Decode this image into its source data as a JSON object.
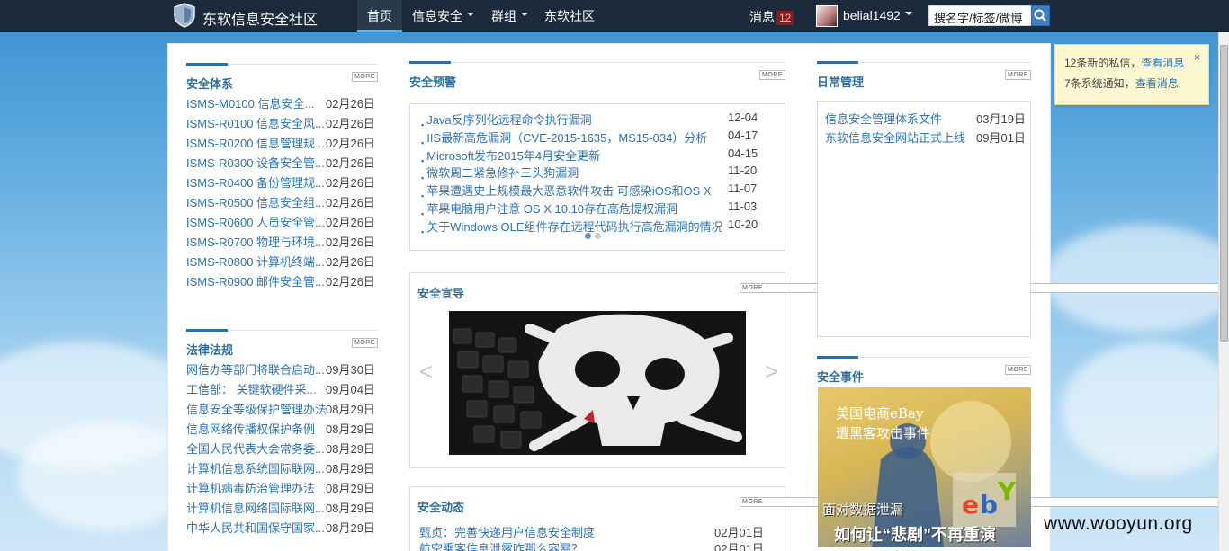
{
  "header": {
    "site_title": "东软信息安全社区",
    "nav": [
      {
        "label": "首页"
      },
      {
        "label": "信息安全"
      },
      {
        "label": "群组"
      },
      {
        "label": "东软社区"
      }
    ],
    "messages_label": "消息",
    "messages_count": "12",
    "username": "belial1492",
    "search_value": "搜名字/标签/微博"
  },
  "more_label": "MORE",
  "security_system": {
    "title": "安全体系",
    "items": [
      {
        "t": "ISMS-M0100 信息安全...",
        "d": "02月26日"
      },
      {
        "t": "ISMS-R0100 信息安全风...",
        "d": "02月26日"
      },
      {
        "t": "ISMS-R0200 信息管理规...",
        "d": "02月26日"
      },
      {
        "t": "ISMS-R0300 设备安全管...",
        "d": "02月26日"
      },
      {
        "t": "ISMS-R0400 备份管理规...",
        "d": "02月26日"
      },
      {
        "t": "ISMS-R0500 信息安全组...",
        "d": "02月26日"
      },
      {
        "t": "ISMS-R0600 人员安全管...",
        "d": "02月26日"
      },
      {
        "t": "ISMS-R0700 物理与环境...",
        "d": "02月26日"
      },
      {
        "t": "ISMS-R0800 计算机终端...",
        "d": "02月26日"
      },
      {
        "t": "ISMS-R0900 邮件安全管...",
        "d": "02月26日"
      }
    ]
  },
  "laws": {
    "title": "法律法规",
    "items": [
      {
        "t": "网信办等部门将联合启动...",
        "d": "09月30日"
      },
      {
        "t": "工信部：  关键软硬件采...",
        "d": "09月04日"
      },
      {
        "t": "信息安全等级保护管理办法",
        "d": "08月29日"
      },
      {
        "t": "信息网络传播权保护条例",
        "d": "08月29日"
      },
      {
        "t": "全国人民代表大会常务委...",
        "d": "08月29日"
      },
      {
        "t": "计算机信息系统国际联网...",
        "d": "08月29日"
      },
      {
        "t": "计算机病毒防治管理办法",
        "d": "08月29日"
      },
      {
        "t": "计算机信息网络国际联网...",
        "d": "08月29日"
      },
      {
        "t": "中华人民共和国保守国家...",
        "d": "08月29日"
      }
    ]
  },
  "alerts": {
    "title": "安全预警",
    "items": [
      {
        "t": "Java反序列化远程命令执行漏洞",
        "d": "12-04"
      },
      {
        "t": "IIS最新高危漏洞（CVE-2015-1635，MS15-034）分析",
        "d": "04-17"
      },
      {
        "t": "Microsoft发布2015年4月安全更新",
        "d": "04-15"
      },
      {
        "t": "微软周二紧急修补三头狗漏洞",
        "d": "11-20"
      },
      {
        "t": "苹果遭遇史上规模最大恶意软件攻击 可感染iOS和OS X",
        "d": "11-07"
      },
      {
        "t": "苹果电脑用户注意 OS X 10.10存在高危提权漏洞",
        "d": "11-03"
      },
      {
        "t": "关于Windows OLE组件存在远程代码执行高危漏洞的情况公",
        "d": "10-20"
      }
    ]
  },
  "promo": {
    "title": "安全宣导",
    "prev": "<",
    "next": ">"
  },
  "news": {
    "title": "安全动态",
    "items": [
      {
        "t": "甄贞：完善快递用户信息安全制度",
        "d": "02月01日"
      },
      {
        "t": "航空乘客信息泄露咋那么容易？",
        "d": "02月01日"
      }
    ]
  },
  "daily": {
    "title": "日常管理",
    "items": [
      {
        "t": "信息安全管理体系文件",
        "d": "03月19日"
      },
      {
        "t": "东软信息安全网站正式上线",
        "d": "09月01日"
      }
    ]
  },
  "events": {
    "title": "安全事件",
    "image_text1": "美国电商eBay",
    "image_text2": "遭黑客攻击事件",
    "image_text3": "面对数据泄漏",
    "image_text4": "如何让“悲剧”不再重演"
  },
  "toast": {
    "line1": "12条新的私信，",
    "link1": "查看消息",
    "line2": "7条系统通知，",
    "link2": "查看消息",
    "close": "×"
  },
  "watermark": "www.wooyun.org"
}
